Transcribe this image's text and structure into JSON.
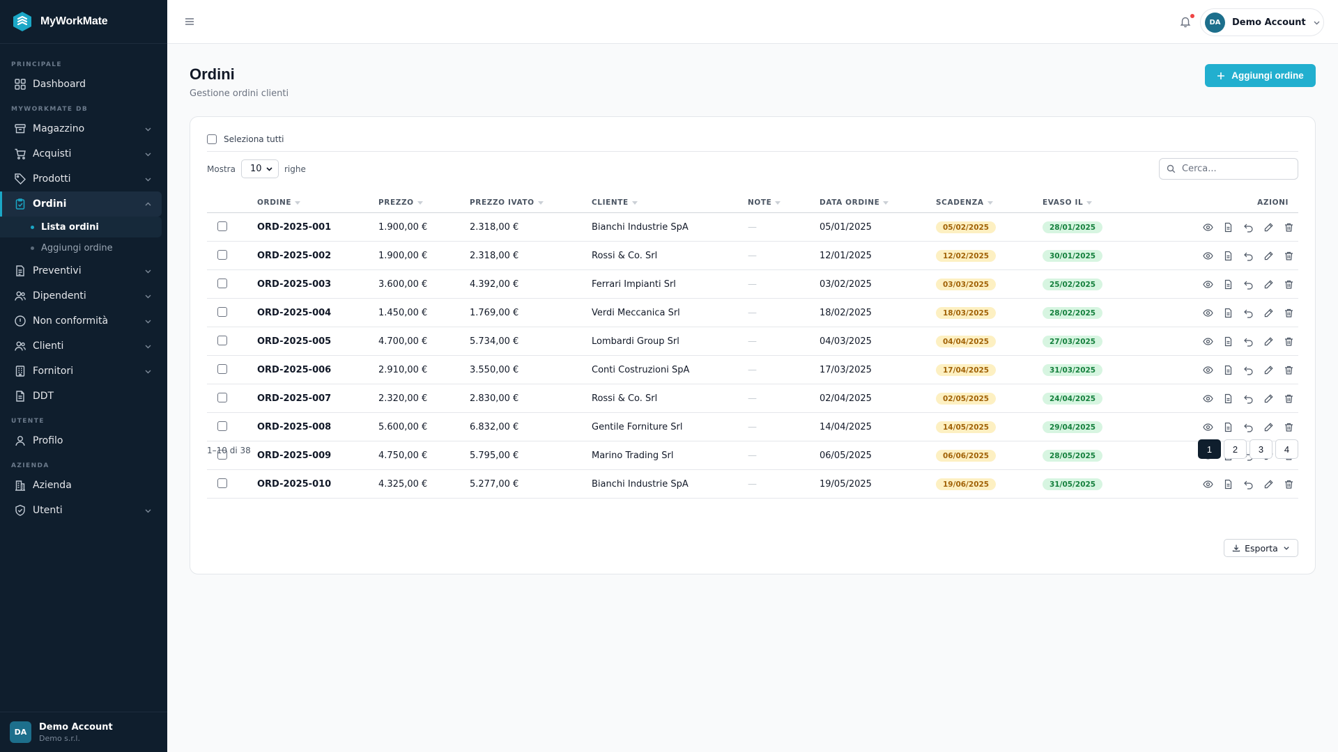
{
  "app": {
    "name": "MyWorkMate"
  },
  "sidebar": {
    "sections": {
      "principale": "PRINCIPALE",
      "db": "MYWORKMATE DB",
      "utente": "UTENTE",
      "azienda": "AZIENDA"
    },
    "dashboard": "Dashboard",
    "magazzino": "Magazzino",
    "acquisti": "Acquisti",
    "prodotti": "Prodotti",
    "ordini": "Ordini",
    "ordini_sub": {
      "lista": "Lista ordini",
      "aggiungi": "Aggiungi ordine"
    },
    "preventivi": "Preventivi",
    "dipendenti": "Dipendenti",
    "non_conformita": "Non conformità",
    "clienti": "Clienti",
    "fornitori": "Fornitori",
    "ddt": "DDT",
    "profilo": "Profilo",
    "azienda": "Azienda",
    "utenti": "Utenti",
    "footer": {
      "initials": "DA",
      "name": "Demo Account",
      "company": "Demo s.r.l."
    }
  },
  "topbar": {
    "user_initials": "DA",
    "user_name": "Demo Account"
  },
  "page": {
    "title": "Ordini",
    "subtitle": "Gestione ordini clienti",
    "add_button": "Aggiungi ordine"
  },
  "table_controls": {
    "select_all": "Seleziona tutti",
    "show_label": "Mostra",
    "rows_value": "10",
    "rows_label": "righe",
    "search_placeholder": "Cerca..."
  },
  "table": {
    "headers": {
      "ordine": "ORDINE",
      "prezzo": "PREZZO",
      "prezzo_ivato": "PREZZO IVATO",
      "cliente": "CLIENTE",
      "note": "NOTE",
      "data_ordine": "DATA ORDINE",
      "scadenza": "SCADENZA",
      "evaso_il": "EVASO IL",
      "azioni": "AZIONI"
    },
    "rows": [
      {
        "ordine": "ORD-2025-001",
        "prezzo": "1.900,00 €",
        "prezzo_ivato": "2.318,00 €",
        "cliente": "Bianchi Industrie SpA",
        "note": "—",
        "data_ordine": "05/01/2025",
        "scadenza": "05/02/2025",
        "evaso_il": "28/01/2025"
      },
      {
        "ordine": "ORD-2025-002",
        "prezzo": "1.900,00 €",
        "prezzo_ivato": "2.318,00 €",
        "cliente": "Rossi & Co. Srl",
        "note": "—",
        "data_ordine": "12/01/2025",
        "scadenza": "12/02/2025",
        "evaso_il": "30/01/2025"
      },
      {
        "ordine": "ORD-2025-003",
        "prezzo": "3.600,00 €",
        "prezzo_ivato": "4.392,00 €",
        "cliente": "Ferrari Impianti Srl",
        "note": "—",
        "data_ordine": "03/02/2025",
        "scadenza": "03/03/2025",
        "evaso_il": "25/02/2025"
      },
      {
        "ordine": "ORD-2025-004",
        "prezzo": "1.450,00 €",
        "prezzo_ivato": "1.769,00 €",
        "cliente": "Verdi Meccanica Srl",
        "note": "—",
        "data_ordine": "18/02/2025",
        "scadenza": "18/03/2025",
        "evaso_il": "28/02/2025"
      },
      {
        "ordine": "ORD-2025-005",
        "prezzo": "4.700,00 €",
        "prezzo_ivato": "5.734,00 €",
        "cliente": "Lombardi Group Srl",
        "note": "—",
        "data_ordine": "04/03/2025",
        "scadenza": "04/04/2025",
        "evaso_il": "27/03/2025"
      },
      {
        "ordine": "ORD-2025-006",
        "prezzo": "2.910,00 €",
        "prezzo_ivato": "3.550,00 €",
        "cliente": "Conti Costruzioni SpA",
        "note": "—",
        "data_ordine": "17/03/2025",
        "scadenza": "17/04/2025",
        "evaso_il": "31/03/2025"
      },
      {
        "ordine": "ORD-2025-007",
        "prezzo": "2.320,00 €",
        "prezzo_ivato": "2.830,00 €",
        "cliente": "Rossi & Co. Srl",
        "note": "—",
        "data_ordine": "02/04/2025",
        "scadenza": "02/05/2025",
        "evaso_il": "24/04/2025"
      },
      {
        "ordine": "ORD-2025-008",
        "prezzo": "5.600,00 €",
        "prezzo_ivato": "6.832,00 €",
        "cliente": "Gentile Forniture Srl",
        "note": "—",
        "data_ordine": "14/04/2025",
        "scadenza": "14/05/2025",
        "evaso_il": "29/04/2025"
      },
      {
        "ordine": "ORD-2025-009",
        "prezzo": "4.750,00 €",
        "prezzo_ivato": "5.795,00 €",
        "cliente": "Marino Trading Srl",
        "note": "—",
        "data_ordine": "06/05/2025",
        "scadenza": "06/06/2025",
        "evaso_il": "28/05/2025"
      },
      {
        "ordine": "ORD-2025-010",
        "prezzo": "4.325,00 €",
        "prezzo_ivato": "5.277,00 €",
        "cliente": "Bianchi Industrie SpA",
        "note": "—",
        "data_ordine": "19/05/2025",
        "scadenza": "19/06/2025",
        "evaso_il": "31/05/2025"
      }
    ]
  },
  "footer": {
    "count": "1–10 di 38",
    "pages": [
      "1",
      "2",
      "3",
      "4"
    ],
    "export": "Esporta"
  },
  "colors": {
    "accent": "#22afcf",
    "sidebar_bg": "#0f1e2d",
    "due_badge": "#fdf0c2",
    "done_badge": "#d7f5e1"
  }
}
